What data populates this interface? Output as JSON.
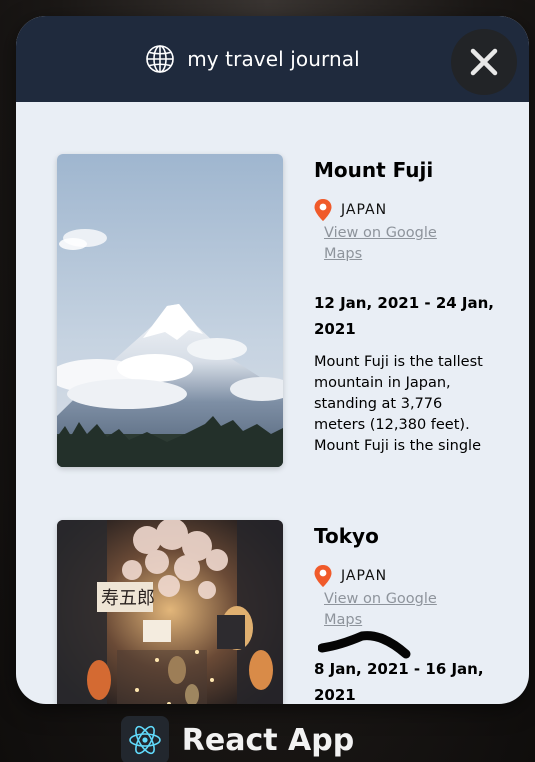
{
  "header": {
    "title": "my travel journal",
    "icon": "globe-icon"
  },
  "close_icon": "close-icon",
  "entries": [
    {
      "place": "Mount Fuji",
      "country": "JAPAN",
      "maps_link": "View on Google Maps",
      "dates": "12 Jan, 2021 - 24 Jan, 2021",
      "description": "Mount Fuji is the tallest mountain in Japan, standing at 3,776 meters (12,380 feet). Mount Fuji is the single most popular tourist",
      "image": "mount-fuji-photo"
    },
    {
      "place": "Tokyo",
      "country": "JAPAN",
      "maps_link": "View on Google Maps",
      "dates": "8 Jan, 2021 - 16 Jan, 2021",
      "image": "tokyo-street-photo"
    }
  ],
  "app": {
    "name": "React App",
    "icon": "react-icon"
  },
  "colors": {
    "header_bg": "#1f2a3d",
    "content_bg": "#e9eef5",
    "pin": "#f05a2a",
    "link": "#8e949c"
  }
}
